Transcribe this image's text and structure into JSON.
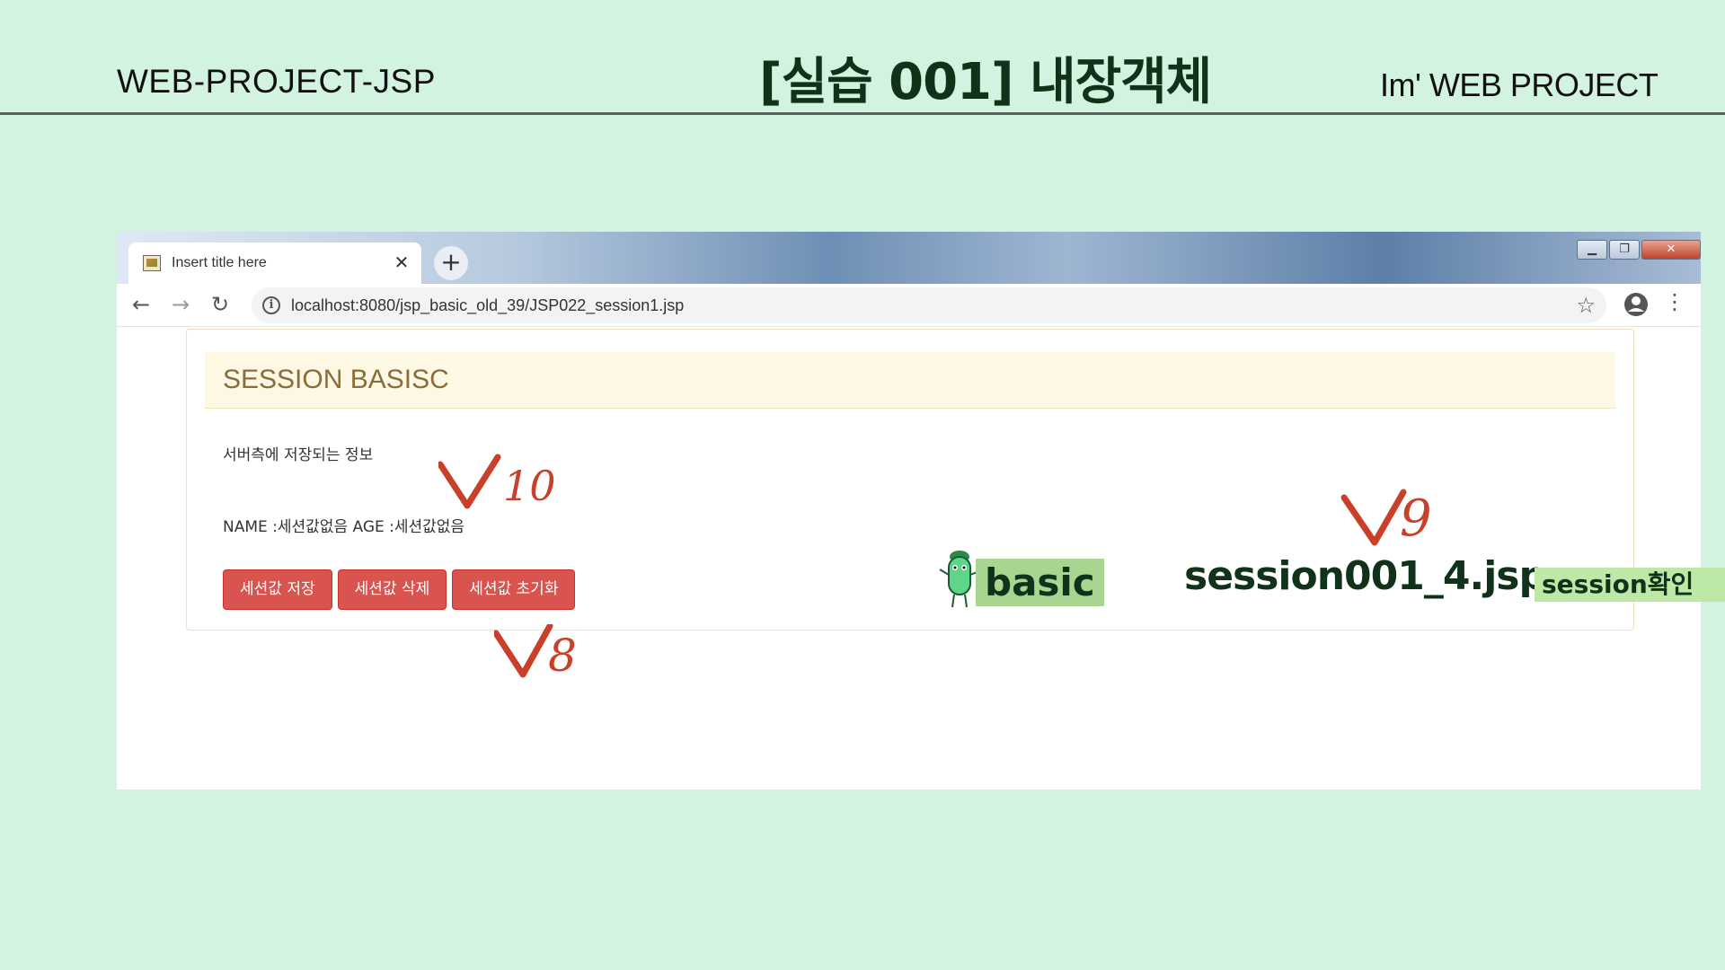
{
  "slide": {
    "left_title": "WEB-PROJECT-JSP",
    "center_title": "[실습 001]  내장객체",
    "right_title": "Im'  WEB PROJECT"
  },
  "browser": {
    "tab_title": "Insert title here",
    "tab_close": "✕",
    "new_tab": "+",
    "url": "localhost:8080/jsp_basic_old_39/JSP022_session1.jsp"
  },
  "page": {
    "panel_title": "SESSION BASISC",
    "info_text": "서버측에 저장되는 정보",
    "name_age_text": "NAME :세션값없음 AGE :세션값없음",
    "buttons": [
      "세션값 저장",
      "세션값 삭제",
      "세션값 초기화"
    ]
  },
  "annotations": {
    "check_marks": [
      "10",
      "9",
      "8"
    ],
    "basic_label": "basic",
    "file_label": "session001_4.jsp",
    "session_label": "session확인"
  },
  "colors": {
    "slide_bg": "#d2f3df",
    "check_mark": "#c9402a",
    "button_danger": "#d9534f",
    "panel_heading_bg": "#fcf8e3",
    "panel_title": "#8a6d3b",
    "tag_basic_bg": "#a8d58f",
    "tag_session_bg": "#bde8a6"
  },
  "icons": [
    "back-arrow-icon",
    "forward-arrow-icon",
    "reload-icon",
    "info-icon",
    "star-icon",
    "account-icon",
    "menu-dots-icon",
    "minimize-icon",
    "maximize-icon",
    "close-icon"
  ]
}
